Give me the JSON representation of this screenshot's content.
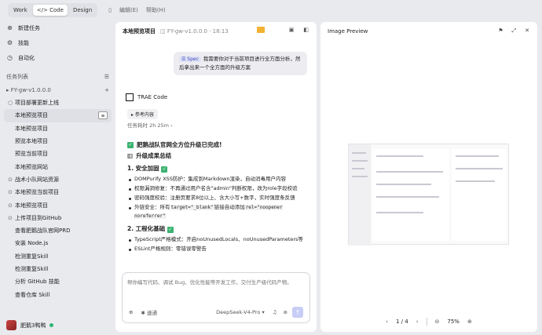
{
  "titlebar": {
    "modes": [
      "Work",
      "Code",
      "Design"
    ],
    "active_mode": "Code",
    "menu": [
      "编辑(E)",
      "帮助(H)"
    ]
  },
  "sidebar": {
    "top_items": [
      {
        "label": "新建任务",
        "icon": "new-task-icon"
      },
      {
        "label": "技能",
        "icon": "skills-icon"
      },
      {
        "label": "自动化",
        "icon": "automation-icon"
      }
    ],
    "section_title": "任务列表",
    "project": "FY-gw-v1.0.0.0",
    "tasks": [
      {
        "label": "项目部署更新上线",
        "icon": "○"
      },
      {
        "label": "本地预览项目",
        "selected": true
      },
      {
        "label": "本地预览项目"
      },
      {
        "label": "预览本地项目"
      },
      {
        "label": "预览当前项目"
      },
      {
        "label": "本地预览网站"
      },
      {
        "label": "战术小队网站资源",
        "icon": "⊙"
      },
      {
        "label": "本地预览当前项目",
        "icon": "⊙"
      },
      {
        "label": "本地预览项目",
        "icon": "⊙"
      },
      {
        "label": "上传项目到GitHub",
        "icon": "⊙"
      },
      {
        "label": "查看肥鹅战队官网PRD"
      },
      {
        "label": "安装 Node.js"
      },
      {
        "label": "检测重复Skill"
      },
      {
        "label": "检测重复Skill"
      },
      {
        "label": "分析 GitHub 技能"
      },
      {
        "label": "查看仓库 Skill"
      }
    ],
    "user": "肥鹅3鸭鸭"
  },
  "main": {
    "title": "本地预览项目",
    "breadcrumb": "FY-gw-v1.0.0.0 · 18:13",
    "user_tag": "Spec",
    "user_message": "我需要你对于当前项目进行全方面分析，然后拿出来一个全方面的升级方案",
    "agent_name": "TRAE Code",
    "reference": "参考内容",
    "duration": "任务耗时 2h 25m",
    "result_title": "肥鹅战队官网全方位升级已完成!",
    "summary_title": "升级成果总结",
    "section1": "1. 安全加固",
    "sec1_items": [
      "DOMPurify XSS防护：集成到Markdown渲染，自动消毒用户内容",
      "权限漏洞修复：不再通过用户名含\"admin\"判断权限，改为role字段校验",
      "密码强度校验：注册页要求8位以上、含大小写+数字，实时强度条反馈"
    ],
    "sec1_last_prefix": "外链安全：所有",
    "sec1_last_code1": "target=\"_blank\"",
    "sec1_last_mid": "链接自动添加",
    "sec1_last_code2": "rel=\"noopener noreferrer\"",
    "section2": "2. 工程化基础",
    "sec2_items": [
      "TypeScript严格模式：开启noUnusedLocals、noUnusedParameters等",
      "ESLint严格规则：零错误零警告"
    ],
    "input_placeholder": "帮你编写代码、调试 Bug、优化性能等开发工作，交付生产级代码产物。",
    "mode_label": "速通",
    "model": "DeepSeek-V4-Pro"
  },
  "preview": {
    "title": "Image Preview",
    "page": "1 / 4",
    "zoom": "75%"
  }
}
